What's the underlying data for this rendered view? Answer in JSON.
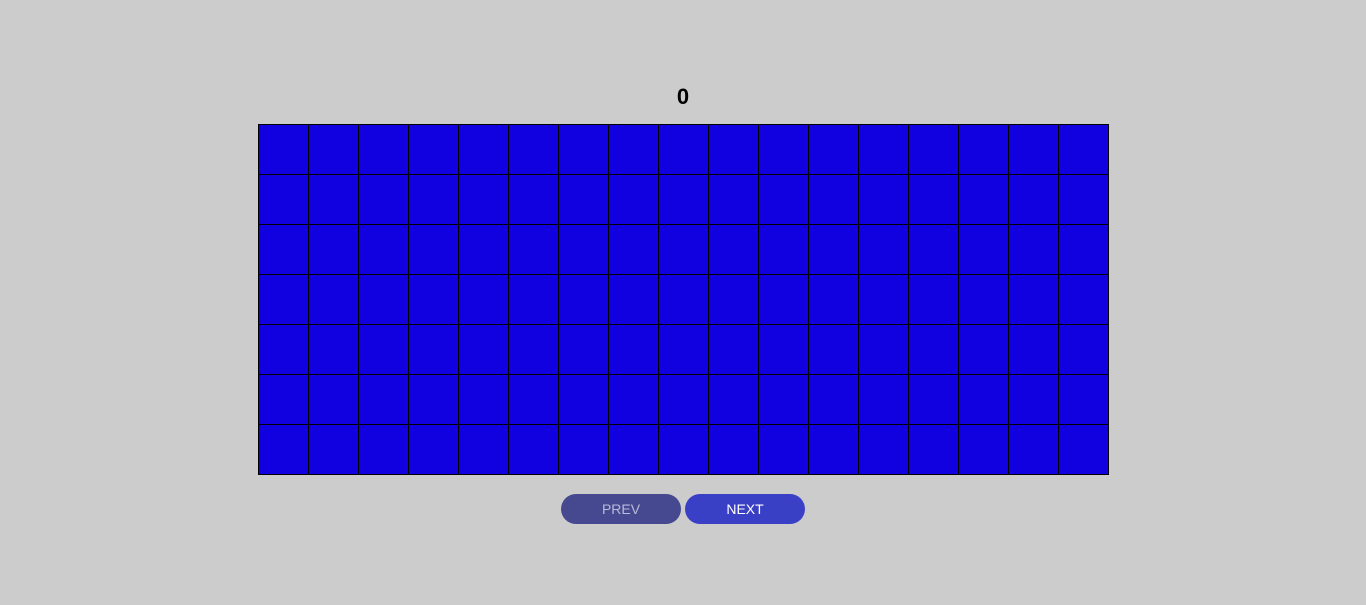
{
  "counter": {
    "value": "0"
  },
  "grid": {
    "rows": 7,
    "cols": 17,
    "cell_color": "#1100e0"
  },
  "controls": {
    "prev_label": "PREV",
    "next_label": "NEXT"
  },
  "colors": {
    "background": "#cccccc",
    "prev_button": "#46498f",
    "next_button": "#3a40c6"
  }
}
